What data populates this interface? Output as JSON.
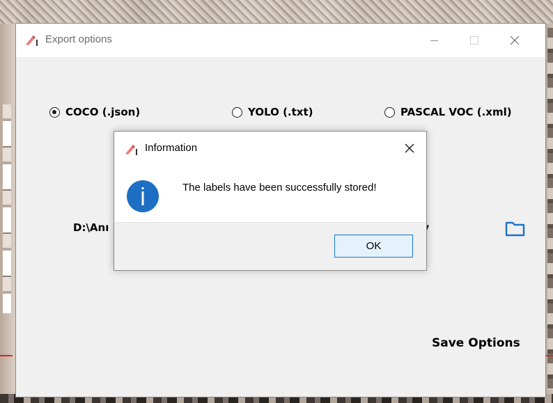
{
  "main_window": {
    "title": "Export options",
    "formats": [
      {
        "label": "COCO (.json)",
        "selected": true
      },
      {
        "label": "YOLO (.txt)",
        "selected": false
      },
      {
        "label": "PASCAL VOC (.xml)",
        "selected": false
      }
    ],
    "path_fragment": "D:\\Anı",
    "directory_fragment": "ry",
    "save_label": "Save Options"
  },
  "dialog": {
    "title": "Information",
    "message": "The labels have been successfully stored!",
    "ok_label": "OK",
    "icon": "info-icon"
  },
  "colors": {
    "window_bg": "#f0f0f0",
    "titlebar_bg": "#ffffff",
    "info_blue": "#1c6fc3",
    "ok_border": "#0f78d7",
    "ok_bg": "#e5f1fb",
    "folder_icon": "#1a73c8"
  }
}
